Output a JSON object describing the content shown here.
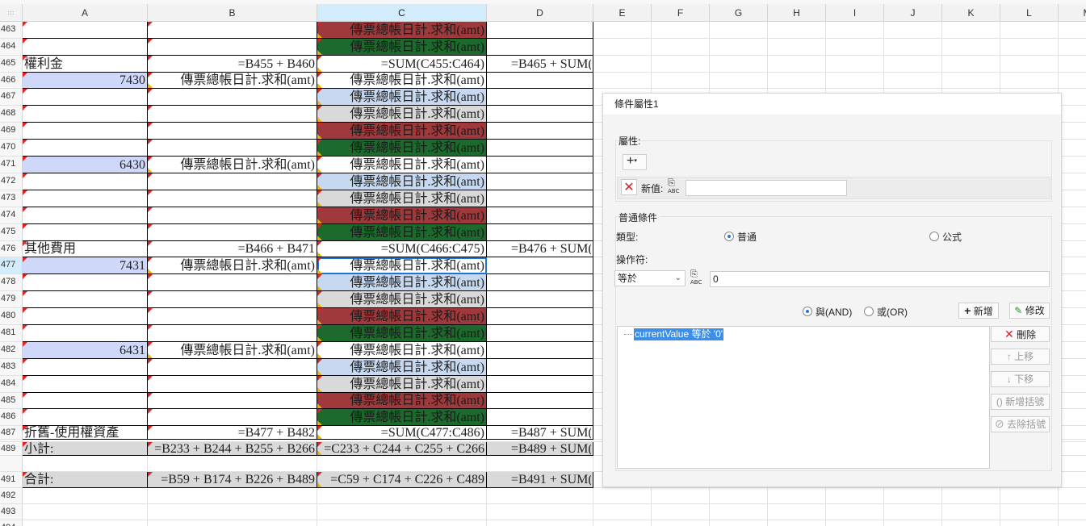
{
  "sheet": {
    "corner_glyph": ":::",
    "columns": [
      "A",
      "B",
      "C",
      "D",
      "E",
      "F",
      "G",
      "H",
      "I",
      "J",
      "K",
      "L",
      "M"
    ],
    "rows": [
      "463",
      "464",
      "465",
      "466",
      "467",
      "468",
      "469",
      "470",
      "471",
      "472",
      "473",
      "474",
      "475",
      "476",
      "477",
      "478",
      "479",
      "480",
      "481",
      "482",
      "483",
      "484",
      "485",
      "486",
      "487",
      "",
      "489",
      "",
      "491",
      "492",
      "493",
      "494"
    ],
    "selected_column": "C",
    "selected_row": "477",
    "cells": {
      "463": {
        "C": "傳票總帳日計.求和(amt)"
      },
      "464": {
        "C": "傳票總帳日計.求和(amt)"
      },
      "465": {
        "A": "權利金",
        "B": "=B455 + B460",
        "C": "=SUM(C455:C464)",
        "D": "=B465 + SUM("
      },
      "466": {
        "A": "7430",
        "B": "傳票總帳日計.求和(amt)",
        "C": "傳票總帳日計.求和(amt)"
      },
      "467": {
        "C": "傳票總帳日計.求和(amt)"
      },
      "468": {
        "C": "傳票總帳日計.求和(amt)"
      },
      "469": {
        "C": "傳票總帳日計.求和(amt)"
      },
      "470": {
        "C": "傳票總帳日計.求和(amt)"
      },
      "471": {
        "A": "6430",
        "B": "傳票總帳日計.求和(amt)",
        "C": "傳票總帳日計.求和(amt)"
      },
      "472": {
        "C": "傳票總帳日計.求和(amt)"
      },
      "473": {
        "C": "傳票總帳日計.求和(amt)"
      },
      "474": {
        "C": "傳票總帳日計.求和(amt)"
      },
      "475": {
        "C": "傳票總帳日計.求和(amt)"
      },
      "476": {
        "A": "其他費用",
        "B": "=B466 + B471",
        "C": "=SUM(C466:C475)",
        "D": "=B476 + SUM("
      },
      "477": {
        "A": "7431",
        "B": "傳票總帳日計.求和(amt)",
        "C": "傳票總帳日計.求和(amt)"
      },
      "478": {
        "C": "傳票總帳日計.求和(amt)"
      },
      "479": {
        "C": "傳票總帳日計.求和(amt)"
      },
      "480": {
        "C": "傳票總帳日計.求和(amt)"
      },
      "481": {
        "C": "傳票總帳日計.求和(amt)"
      },
      "482": {
        "A": "6431",
        "B": "傳票總帳日計.求和(amt)",
        "C": "傳票總帳日計.求和(amt)"
      },
      "483": {
        "C": "傳票總帳日計.求和(amt)"
      },
      "484": {
        "C": "傳票總帳日計.求和(amt)"
      },
      "485": {
        "C": "傳票總帳日計.求和(amt)"
      },
      "486": {
        "C": "傳票總帳日計.求和(amt)"
      },
      "487": {
        "A": "折舊-使用權資產",
        "B": "=B477 + B482",
        "C": "=SUM(C477:C486)",
        "D": "=B487 + SUM("
      },
      "489": {
        "A": "小計:",
        "B": "=B233 + B244 + B255 + B266",
        "C": "=C233 + C244 + C255 + C266",
        "D": "=B489 + SUM("
      },
      "491": {
        "A": "合計:",
        "B": "=B59 + B174 + B226 + B489",
        "C": "=C59 + C174 + C226 + C489",
        "D": "=B491 + SUM("
      }
    },
    "colors": {
      "red": "#a0393b",
      "green": "#1c6a2c",
      "blue": "#c6d9f0",
      "gray": "#d9d9d9",
      "lavender": "#d0d8f9",
      "selection": "#1e73d4"
    }
  },
  "dialog": {
    "title": "條件屬性1",
    "property_group_label": "屬性:",
    "add_menu_glyph": "+",
    "new_value_label": "新值:",
    "new_value_input": "",
    "abc_label": "ABC",
    "normal_condition_label": "普通條件",
    "type_label": "類型:",
    "type_normal": "普通",
    "type_formula": "公式",
    "operator_label": "操作符:",
    "operator_value": "等於",
    "operand_value": "0",
    "and_label": "與(AND)",
    "or_label": "或(OR)",
    "add_button": "新增",
    "modify_button": "修改",
    "delete_button": "刪除",
    "move_up_button": "上移",
    "move_down_button": "下移",
    "add_bracket_button": "新增括號",
    "remove_bracket_button": "去除括號",
    "condition_item": "currentValue 等於 '0'"
  }
}
